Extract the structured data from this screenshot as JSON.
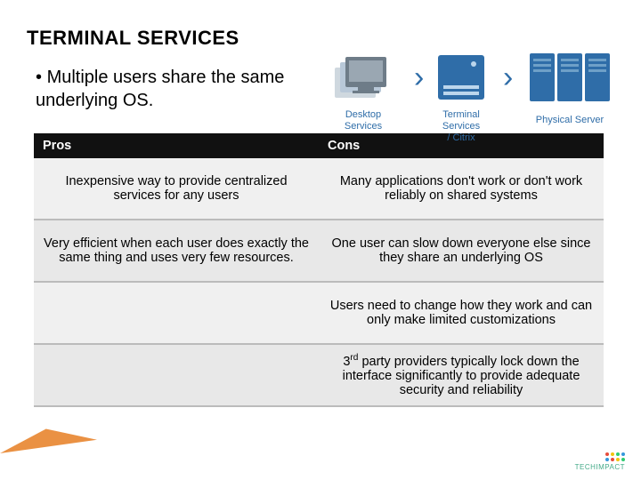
{
  "title": "TERMINAL SERVICES",
  "bullet": "Multiple users share the same underlying OS.",
  "diagram": {
    "labels": [
      "Desktop Services",
      "Terminal Services / Citrix",
      "Physical Server"
    ],
    "colors": {
      "blue": "#2f6da8",
      "grey": "#888888",
      "light": "#b8c8d8"
    }
  },
  "table": {
    "headers": [
      "Pros",
      "Cons"
    ],
    "rows": [
      {
        "pro": "Inexpensive way to provide centralized services for any users",
        "con": "Many applications don't work or don't work reliably on shared systems"
      },
      {
        "pro": "Very efficient when each user does exactly the same thing and uses very few resources.",
        "con": "One user can slow down everyone else since they share an underlying OS"
      },
      {
        "pro": "",
        "con": "Users need to change how they work and can only make limited customizations"
      },
      {
        "pro": "",
        "con_html": "3<sup>rd</sup> party providers typically lock down the interface significantly to provide adequate security and reliability"
      }
    ]
  },
  "logo_text": "TECHIMPACT"
}
